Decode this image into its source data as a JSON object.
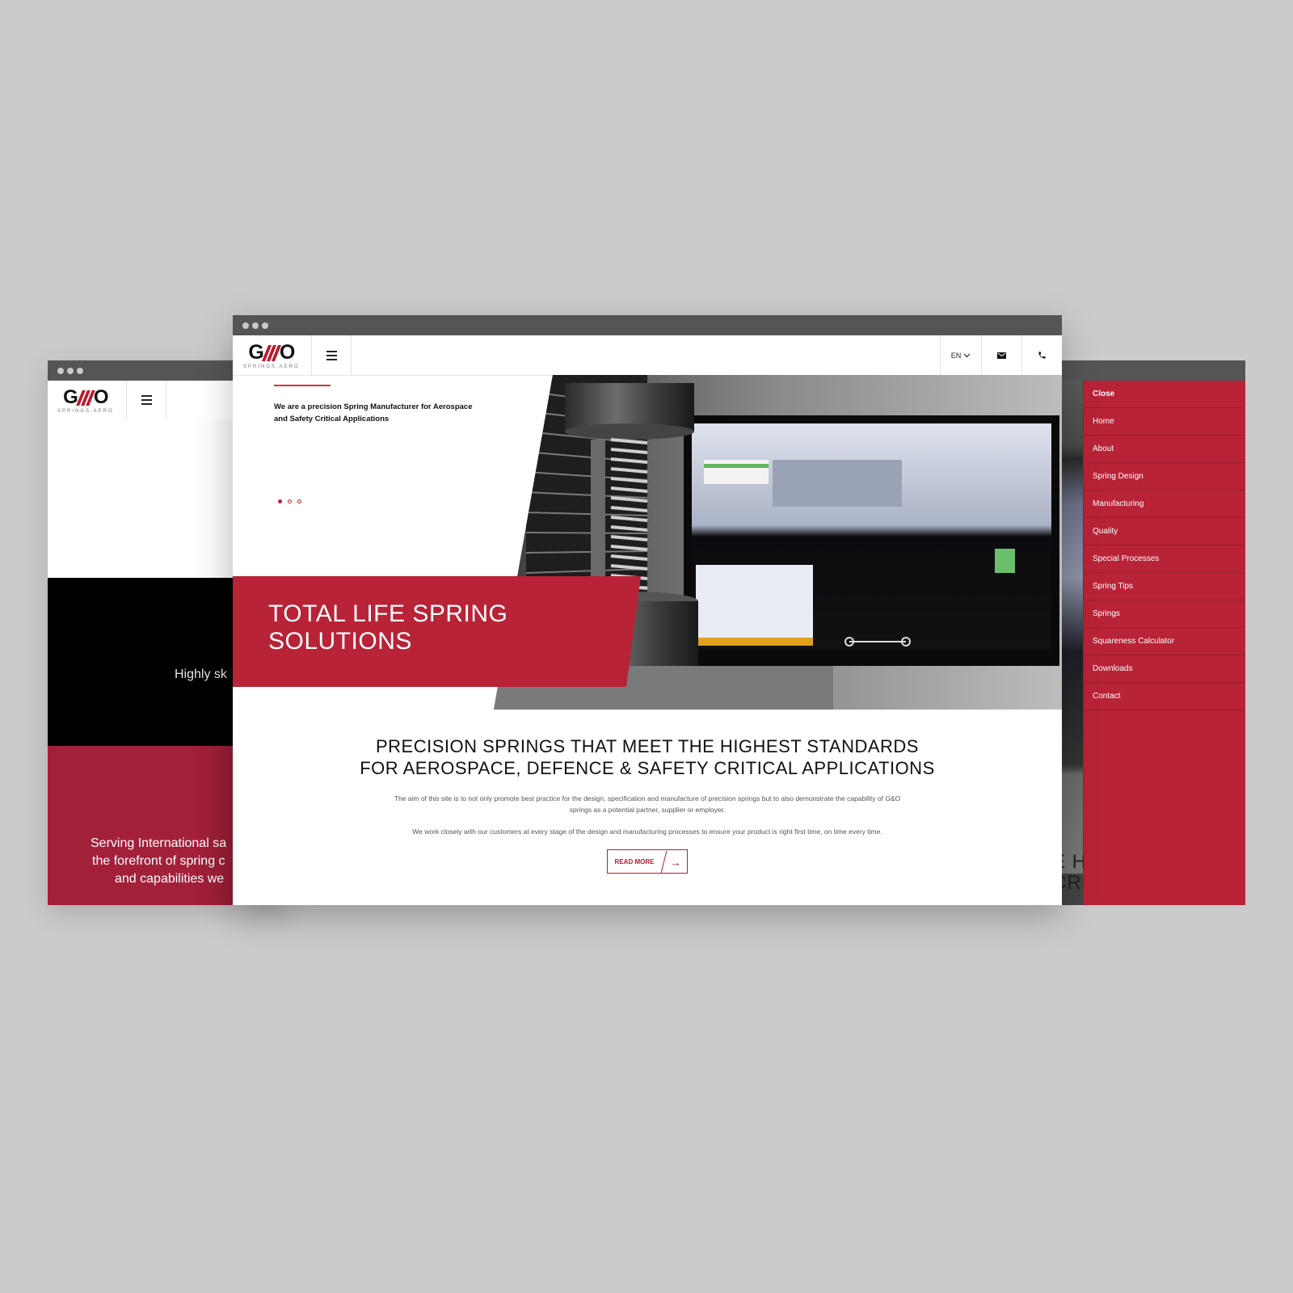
{
  "brand": {
    "logo_main": "G///O",
    "logo_sub": "SPRINGS.AERO",
    "accent_color": "#b82337"
  },
  "left_window": {
    "black_section_text": "Highly sk",
    "red_section_lines": [
      "Serving International sa",
      "the forefront of spring c",
      "and capabilities we"
    ]
  },
  "center_window": {
    "nav": {
      "language": "EN",
      "mail_icon": "envelope-icon",
      "phone_icon": "phone-icon",
      "menu_icon": "hamburger-icon"
    },
    "hero": {
      "intro": "We are a precision Spring Manufacturer for Aerospace and Safety Critical Applications",
      "banner_line1": "TOTAL LIFE SPRING",
      "banner_line2": "SOLUTIONS",
      "carousel": {
        "count": 3,
        "active_index": 0
      }
    },
    "intro_section": {
      "heading_line1": "PRECISION SPRINGS THAT MEET THE HIGHEST STANDARDS",
      "heading_line2": "FOR AEROSPACE, DEFENCE & SAFETY CRITICAL APPLICATIONS",
      "paragraph1_line1": "The aim of this site is to not only promote best practice for the design, specification and manufacture of precision springs but to also demonstrate the capability of G&O",
      "paragraph1_line2": "springs as a potential partner, supplier or employer.",
      "paragraph2": "We work closely with our customers at every stage of the design and manufacturing processes to ensure your product is right first time, on time every time.",
      "read_more_label": "READ MORE",
      "read_more_icon": "arrow-right-icon"
    }
  },
  "right_window": {
    "heading_fragment_line1": "E H",
    "heading_fragment_line2": "CR",
    "menu": [
      {
        "label": "Close"
      },
      {
        "label": "Home"
      },
      {
        "label": "About"
      },
      {
        "label": "Spring Design"
      },
      {
        "label": "Manufacturing"
      },
      {
        "label": "Quality"
      },
      {
        "label": "Special Processes"
      },
      {
        "label": "Spring Tips"
      },
      {
        "label": "Springs"
      },
      {
        "label": "Squareness Calculator"
      },
      {
        "label": "Downloads"
      },
      {
        "label": "Contact"
      }
    ]
  }
}
